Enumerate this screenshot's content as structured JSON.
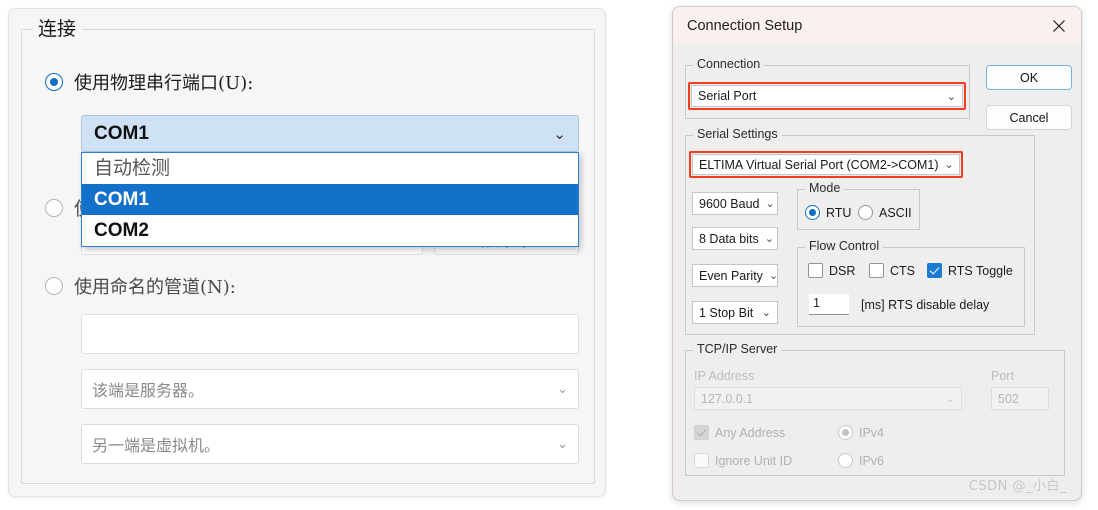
{
  "left_panel": {
    "group_title": "连接",
    "option_serial": {
      "label": "使用物理串行端口(U):",
      "selected": true
    },
    "port_combo": {
      "value": "COM1",
      "caret": "chevron-down-icon",
      "expanded": true,
      "options": [
        {
          "label": "自动检测",
          "selected": false
        },
        {
          "label": "COM1",
          "selected": true
        },
        {
          "label": "COM2",
          "selected": false
        }
      ]
    },
    "option_output_file": {
      "label": "使用输出文件(O):",
      "selected": false
    },
    "browse_button": "浏览(B)...",
    "option_named_pipe": {
      "label": "使用命名的管道(N):",
      "selected": false
    },
    "pipe_name_value": "",
    "pipe_end_combo": {
      "value": "该端是服务器。",
      "caret": "chevron-down-icon"
    },
    "pipe_other_end_combo": {
      "value": "另一端是虚拟机。",
      "caret": "chevron-down-icon"
    }
  },
  "right_dialog": {
    "title": "Connection Setup",
    "close_icon": "close-icon",
    "buttons": {
      "ok": "OK",
      "cancel": "Cancel"
    },
    "connection_group": {
      "title": "Connection",
      "combo_value": "Serial Port",
      "caret": "chevron-down-icon",
      "highlighted": true
    },
    "serial_settings": {
      "title": "Serial Settings",
      "device_combo": {
        "value": "ELTIMA Virtual Serial Port (COM2->COM1)",
        "caret": "chevron-down-icon",
        "highlighted": true
      },
      "baud_combo": "9600 Baud",
      "data_bits_combo": "8 Data bits",
      "parity_combo": "Even Parity",
      "stop_bits_combo": "1 Stop Bit",
      "mode_group": {
        "title": "Mode",
        "options": [
          {
            "label": "RTU",
            "selected": true
          },
          {
            "label": "ASCII",
            "selected": false
          }
        ]
      },
      "flow_control_group": {
        "title": "Flow Control",
        "checkboxes": [
          {
            "label": "DSR",
            "checked": false
          },
          {
            "label": "CTS",
            "checked": false
          },
          {
            "label": "RTS Toggle",
            "checked": true
          }
        ],
        "rts_delay_value": "1",
        "rts_delay_label": "[ms] RTS disable delay"
      }
    },
    "tcpip_server": {
      "title": "TCP/IP Server",
      "ip_address_label": "IP Address",
      "ip_address_value": "127.0.0.1",
      "ip_caret": "chevron-down-icon",
      "port_label": "Port",
      "port_value": "502",
      "any_address": {
        "label": "Any Address",
        "checked": true,
        "disabled": true
      },
      "ignore_unit_id": {
        "label": "Ignore Unit ID",
        "checked": false,
        "disabled": true
      },
      "ipv4": {
        "label": "IPv4",
        "selected": true,
        "disabled": true
      },
      "ipv6": {
        "label": "IPv6",
        "selected": false,
        "disabled": true
      }
    }
  },
  "watermark": "CSDN @_小白_",
  "colors": {
    "accent_blue": "#0d6fc4",
    "selection_blue": "#1471c9",
    "highlight_red": "#f03d1e",
    "combo_fill": "#cfe2f5",
    "titlebar": "#faf0ef"
  }
}
